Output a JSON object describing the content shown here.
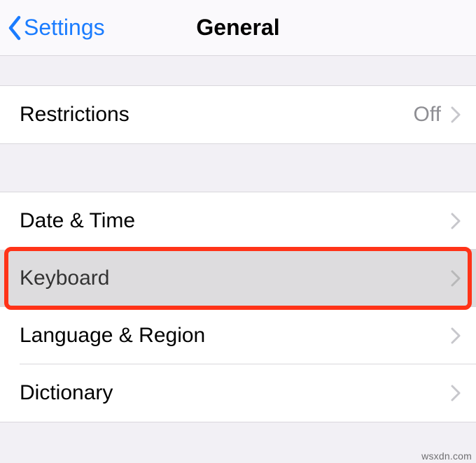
{
  "nav": {
    "back_label": "Settings",
    "title": "General"
  },
  "group1": {
    "restrictions": {
      "label": "Restrictions",
      "value": "Off"
    }
  },
  "group2": {
    "date_time": {
      "label": "Date & Time"
    },
    "keyboard": {
      "label": "Keyboard"
    },
    "language_region": {
      "label": "Language & Region"
    },
    "dictionary": {
      "label": "Dictionary"
    }
  },
  "watermark": "wsxdn.com"
}
